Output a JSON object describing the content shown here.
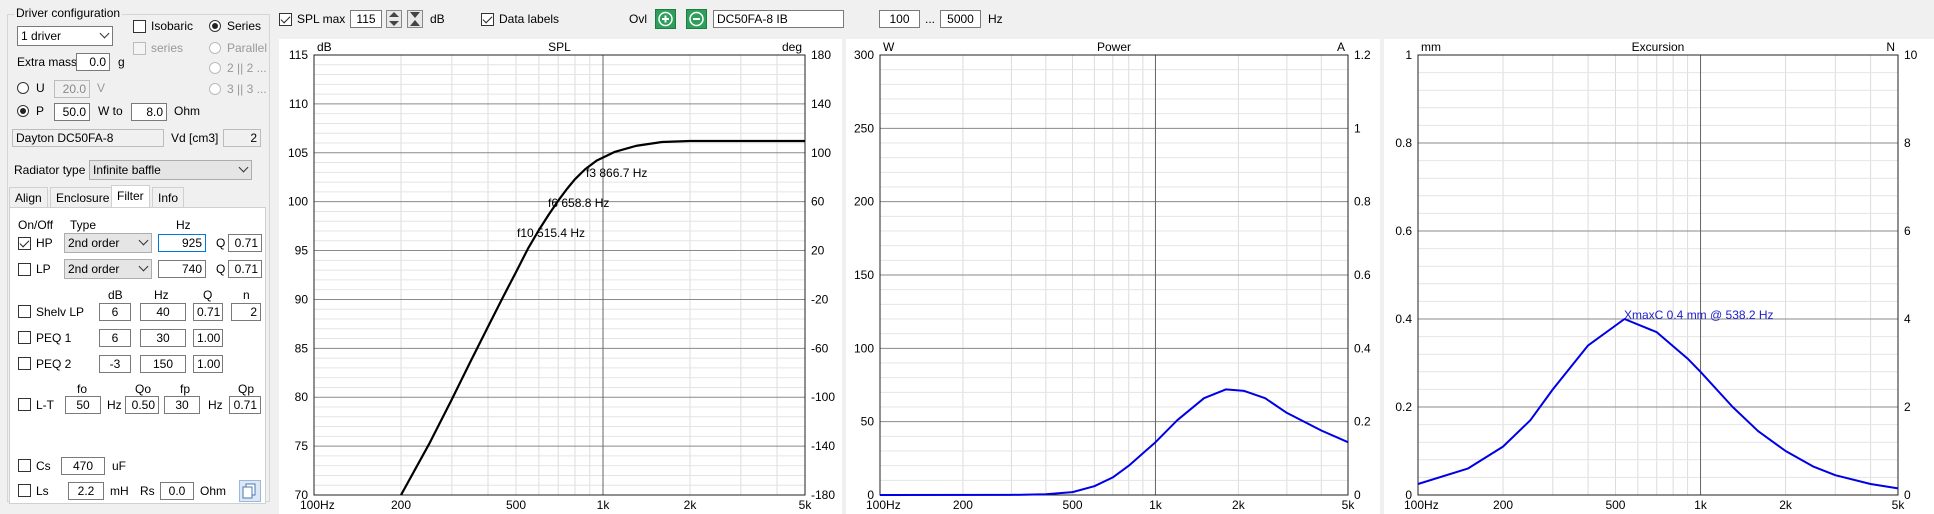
{
  "left_panel": {
    "group_title": "Driver configuration",
    "drivers_select": "1 driver",
    "isobaric_label": "Isobaric",
    "series_label": "Series",
    "series_cb_label": "series",
    "parallel_label": "Parallel",
    "p2_label": "2 || 2 ...",
    "p3_label": "3 || 3 ...",
    "extra_mass_label": "Extra mass",
    "extra_mass_value": "0.0",
    "extra_mass_unit": "g",
    "u_label": "U",
    "u_value": "20.0",
    "u_unit": "V",
    "p_label": "P",
    "p_value": "50.0",
    "w_to_label": "W to",
    "ohm_value": "8.0",
    "ohm_unit": "Ohm",
    "driver_name": "Dayton DC50FA-8",
    "vd_label": "Vd [cm3]",
    "vd_value": "2",
    "radiator_label": "Radiator type",
    "radiator_value": "Infinite baffle",
    "tabs": [
      "Align",
      "Enclosure",
      "Filter",
      "Info"
    ],
    "filter": {
      "col_onoff": "On/Off",
      "col_type": "Type",
      "col_hz": "Hz",
      "hp_label": "HP",
      "hp_type": "2nd order",
      "hp_hz": "925",
      "q_label": "Q",
      "hp_q": "0.71",
      "lp_label": "LP",
      "lp_type": "2nd order",
      "lp_hz": "740",
      "lp_q": "0.71",
      "h_db": "dB",
      "h_hz": "Hz",
      "h_q": "Q",
      "h_n": "n",
      "shelv_label": "Shelv LP",
      "shelv_db": "6",
      "shelv_hz": "40",
      "shelv_q": "0.71",
      "shelv_n": "2",
      "peq1_label": "PEQ 1",
      "peq1_db": "6",
      "peq1_hz": "30",
      "peq1_q": "1.00",
      "peq2_label": "PEQ 2",
      "peq2_db": "-3",
      "peq2_hz": "150",
      "peq2_q": "1.00",
      "h_fo": "fo",
      "h_qo": "Qo",
      "h_fp": "fp",
      "h_qp": "Qp",
      "lt_label": "L-T",
      "lt_fo": "50",
      "lt_hz1": "Hz",
      "lt_qo": "0.50",
      "lt_fp": "30",
      "lt_hz2": "Hz",
      "lt_qp": "0.71",
      "cs_label": "Cs",
      "cs_value": "470",
      "cs_unit": "uF",
      "ls_label": "Ls",
      "ls_value": "2.2",
      "ls_unit": "mH",
      "rs_label": "Rs",
      "rs_value": "0.0",
      "rs_unit": "Ohm"
    }
  },
  "toolbar": {
    "spl_max_label": "SPL max",
    "spl_max_value": "115",
    "db_unit": "dB",
    "data_labels_label": "Data labels",
    "ovl_label": "Ovl",
    "overlay_name": "DC50FA-8 IB",
    "freq_from": "100",
    "freq_sep": "...",
    "freq_to": "5000",
    "freq_unit": "Hz"
  },
  "colors": {
    "curve_spl": "#000000",
    "curve_power": "#0000e6",
    "curve_exc": "#0000e6",
    "add": "#2e9e5b"
  },
  "chart_data": [
    {
      "type": "line",
      "title": "SPL",
      "ylabel": "dB",
      "y2label": "deg",
      "xscale": "log",
      "xlim": [
        100,
        5000
      ],
      "ylim": [
        70,
        115
      ],
      "y2lim": [
        -180,
        180
      ],
      "xticks": [
        "100Hz",
        "200",
        "500",
        "1k",
        "2k",
        "5k"
      ],
      "yticks": [
        "70",
        "75",
        "80",
        "85",
        "90",
        "95",
        "100",
        "105",
        "110",
        "115"
      ],
      "y2ticks": [
        "-180",
        "-140",
        "-100",
        "-60",
        "-20",
        "20",
        "60",
        "100",
        "140",
        "180"
      ],
      "grid": true,
      "series": [
        {
          "x": [
            200,
            250,
            300,
            350,
            400,
            450,
            500,
            550,
            600,
            650,
            700,
            750,
            800,
            866.7,
            950,
            1100,
            1300,
            1600,
            2000,
            2500,
            3000,
            4000,
            5000
          ],
          "y": [
            70,
            75.2,
            79.8,
            83.8,
            87.2,
            90.2,
            92.8,
            95.2,
            97.1,
            98.7,
            100.1,
            101.3,
            102.3,
            103.3,
            104.2,
            105.1,
            105.7,
            106.1,
            106.2,
            106.2,
            106.2,
            106.2,
            106.2
          ]
        }
      ],
      "annotations": [
        "f3 866.7 Hz",
        "f6 658.8 Hz",
        "f10 515.4 Hz"
      ]
    },
    {
      "type": "line",
      "title": "Power",
      "ylabel": "W",
      "y2label": "A",
      "xscale": "log",
      "xlim": [
        100,
        5000
      ],
      "ylim": [
        0,
        300
      ],
      "y2lim": [
        0,
        1.2
      ],
      "xticks": [
        "100Hz",
        "200",
        "500",
        "1k",
        "2k",
        "5k"
      ],
      "yticks": [
        "0",
        "50",
        "100",
        "150",
        "200",
        "250",
        "300"
      ],
      "y2ticks": [
        "0",
        "0.2",
        "0.4",
        "0.6",
        "0.8",
        "1",
        "1.2"
      ],
      "grid": true,
      "series": [
        {
          "x": [
            100,
            300,
            400,
            500,
            600,
            700,
            800,
            1000,
            1200,
            1500,
            1800,
            2100,
            2500,
            3000,
            4000,
            5000
          ],
          "y": [
            0,
            0.1,
            0.5,
            2,
            6,
            12,
            20,
            36,
            51,
            66,
            72,
            71,
            66,
            56,
            44,
            36
          ]
        }
      ]
    },
    {
      "type": "line",
      "title": "Excursion",
      "ylabel": "mm",
      "y2label": "N",
      "xscale": "log",
      "xlim": [
        100,
        5000
      ],
      "ylim": [
        0,
        1
      ],
      "y2lim": [
        0,
        10
      ],
      "xticks": [
        "100Hz",
        "200",
        "500",
        "1k",
        "2k",
        "5k"
      ],
      "yticks": [
        "0",
        "0.2",
        "0.4",
        "0.6",
        "0.8",
        "1"
      ],
      "y2ticks": [
        "0",
        "2",
        "4",
        "6",
        "8",
        "10"
      ],
      "grid": true,
      "series": [
        {
          "x": [
            100,
            150,
            200,
            250,
            300,
            400,
            538.2,
            700,
            900,
            1000,
            1300,
            1600,
            2000,
            2500,
            3000,
            4000,
            5000
          ],
          "y": [
            0.025,
            0.06,
            0.11,
            0.17,
            0.24,
            0.34,
            0.4,
            0.37,
            0.31,
            0.28,
            0.2,
            0.145,
            0.1,
            0.065,
            0.045,
            0.025,
            0.015
          ]
        }
      ],
      "annotations": [
        "XmaxC 0.4 mm  @ 538.2 Hz"
      ]
    }
  ]
}
